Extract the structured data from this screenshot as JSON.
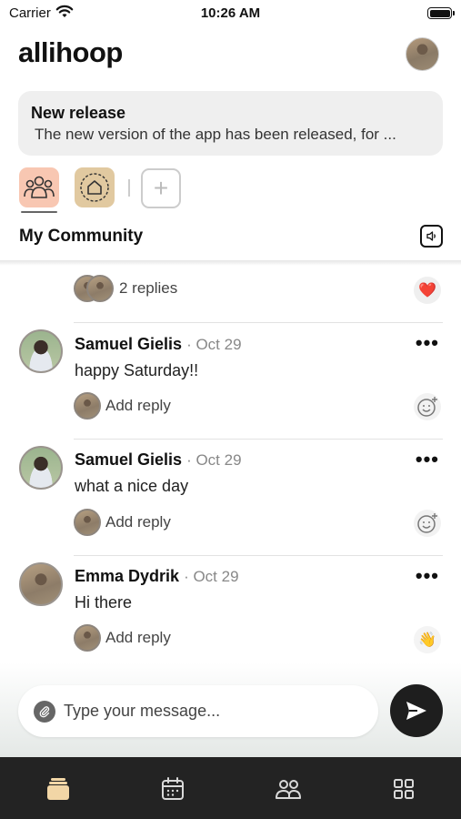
{
  "status_bar": {
    "carrier": "Carrier",
    "time": "10:26 AM"
  },
  "header": {
    "logo": "allihoop"
  },
  "announcement": {
    "title": "New release",
    "text": "The new version of the app has been released, for ..."
  },
  "community": {
    "title": "My Community"
  },
  "feed": {
    "thread_replies": "2 replies",
    "thread_reaction": "❤️",
    "posts": [
      {
        "author": "Samuel Gielis",
        "date": "· Oct 29",
        "message": "happy Saturday!!",
        "reply_label": "Add reply",
        "more": "•••"
      },
      {
        "author": "Samuel Gielis",
        "date": "· Oct 29",
        "message": "what a nice day",
        "reply_label": "Add reply",
        "more": "•••"
      },
      {
        "author": "Emma Dydrik",
        "date": "· Oct 29",
        "message": "Hi there",
        "reply_label": "Add reply",
        "reaction": "👋",
        "more": "•••"
      }
    ]
  },
  "composer": {
    "placeholder": "Type your message..."
  },
  "tabbar": {
    "items": [
      "feed-icon",
      "calendar-icon",
      "people-icon",
      "grid-icon"
    ],
    "active": "feed-icon",
    "active_color": "#f2d6a6"
  },
  "colors": {
    "people_tab": "#f8c7b2",
    "home_tab": "#e1c9a0",
    "tabbar_bg": "#232323"
  },
  "icons": {
    "add_community": "+",
    "attach": "paperclip-icon",
    "send": "send-icon"
  }
}
